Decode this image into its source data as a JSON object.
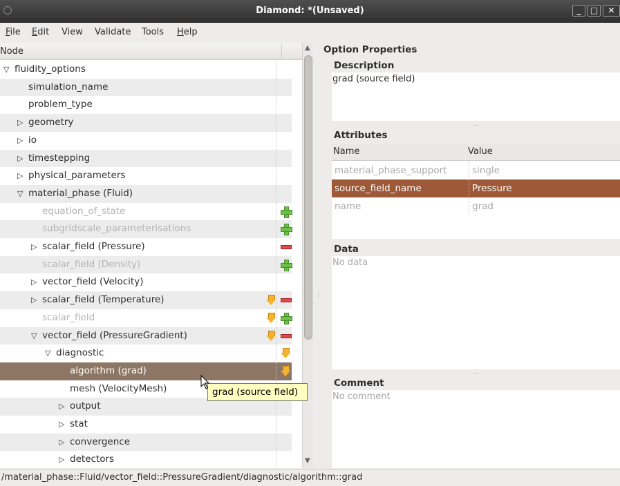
{
  "window": {
    "title": "Diamond: *(Unsaved)",
    "buttons": {
      "minimize": "_",
      "maximize": "□",
      "close": "✕"
    }
  },
  "menu": [
    {
      "label": "File",
      "u": "F",
      "rest": "ile"
    },
    {
      "label": "Edit",
      "u": "E",
      "rest": "dit"
    },
    {
      "label": "View",
      "u": "",
      "rest": "View"
    },
    {
      "label": "Validate",
      "u": "",
      "rest": "Validate"
    },
    {
      "label": "Tools",
      "u": "",
      "rest": "Tools"
    },
    {
      "label": "Help",
      "u": "H",
      "rest": "elp"
    }
  ],
  "tree": {
    "column_header": "Node",
    "rows": [
      {
        "label": "fluidity_options",
        "expander": "open",
        "level": 0,
        "state": "normal",
        "icons": []
      },
      {
        "label": "simulation_name",
        "expander": "none",
        "level": 1,
        "state": "normal",
        "icons": []
      },
      {
        "label": "problem_type",
        "expander": "none",
        "level": 1,
        "state": "normal",
        "icons": []
      },
      {
        "label": "geometry",
        "expander": "closed",
        "level": 1,
        "state": "normal",
        "icons": []
      },
      {
        "label": "io",
        "expander": "closed",
        "level": 1,
        "state": "normal",
        "icons": []
      },
      {
        "label": "timestepping",
        "expander": "closed",
        "level": 1,
        "state": "normal",
        "icons": []
      },
      {
        "label": "physical_parameters",
        "expander": "closed",
        "level": 1,
        "state": "normal",
        "icons": []
      },
      {
        "label": "material_phase (Fluid)",
        "expander": "open",
        "level": 1,
        "state": "normal",
        "icons": []
      },
      {
        "label": "equation_of_state",
        "expander": "none",
        "level": 2,
        "state": "inactive",
        "icons": [
          "add"
        ]
      },
      {
        "label": "subgridscale_parameterisations",
        "expander": "none",
        "level": 2,
        "state": "inactive",
        "icons": [
          "add"
        ]
      },
      {
        "label": "scalar_field (Pressure)",
        "expander": "closed",
        "level": 2,
        "state": "normal",
        "icons": [
          "remove"
        ]
      },
      {
        "label": "scalar_field (Density)",
        "expander": "none",
        "level": 2,
        "state": "inactive",
        "icons": [
          "add"
        ]
      },
      {
        "label": "vector_field (Velocity)",
        "expander": "closed",
        "level": 2,
        "state": "normal",
        "icons": []
      },
      {
        "label": "scalar_field (Temperature)",
        "expander": "closed",
        "level": 2,
        "state": "normal",
        "icons": [
          "duplicate",
          "remove"
        ]
      },
      {
        "label": "scalar_field",
        "expander": "none",
        "level": 2,
        "state": "inactive",
        "icons": [
          "duplicate",
          "add"
        ]
      },
      {
        "label": "vector_field (PressureGradient)",
        "expander": "open",
        "level": 2,
        "state": "normal",
        "icons": [
          "duplicate",
          "remove"
        ]
      },
      {
        "label": "diagnostic",
        "expander": "open",
        "level": 3,
        "state": "normal",
        "icons": [
          "duplicate"
        ]
      },
      {
        "label": "algorithm (grad)",
        "expander": "none",
        "level": 4,
        "state": "selected",
        "icons": [
          "duplicate"
        ]
      },
      {
        "label": "mesh (VelocityMesh)",
        "expander": "none",
        "level": 4,
        "state": "normal",
        "icons": []
      },
      {
        "label": "output",
        "expander": "closed",
        "level": 4,
        "state": "normal",
        "icons": []
      },
      {
        "label": "stat",
        "expander": "closed",
        "level": 4,
        "state": "normal",
        "icons": []
      },
      {
        "label": "convergence",
        "expander": "closed",
        "level": 4,
        "state": "normal",
        "icons": []
      },
      {
        "label": "detectors",
        "expander": "closed",
        "level": 4,
        "state": "normal",
        "icons": []
      }
    ]
  },
  "tooltip": "grad (source field)",
  "properties": {
    "heading": "Option Properties",
    "description_title": "Description",
    "description_text": "grad (source field)",
    "attributes_title": "Attributes",
    "attr_col_name": "Name",
    "attr_col_value": "Value",
    "attributes": [
      {
        "name": "material_phase_support",
        "value": "single",
        "state": "inactive"
      },
      {
        "name": "source_field_name",
        "value": "Pressure",
        "state": "selected"
      },
      {
        "name": "name",
        "value": "grad",
        "state": "inactive"
      }
    ],
    "data_title": "Data",
    "data_text": "No data",
    "comment_title": "Comment",
    "comment_text": "No comment"
  },
  "statusbar": "/material_phase::Fluid/vector_field::PressureGradient/diagnostic/algorithm::grad",
  "colors": {
    "selection_tree": "#8d7764",
    "selection_attr": "#9e5a38",
    "tooltip_bg": "#ffffbf"
  }
}
